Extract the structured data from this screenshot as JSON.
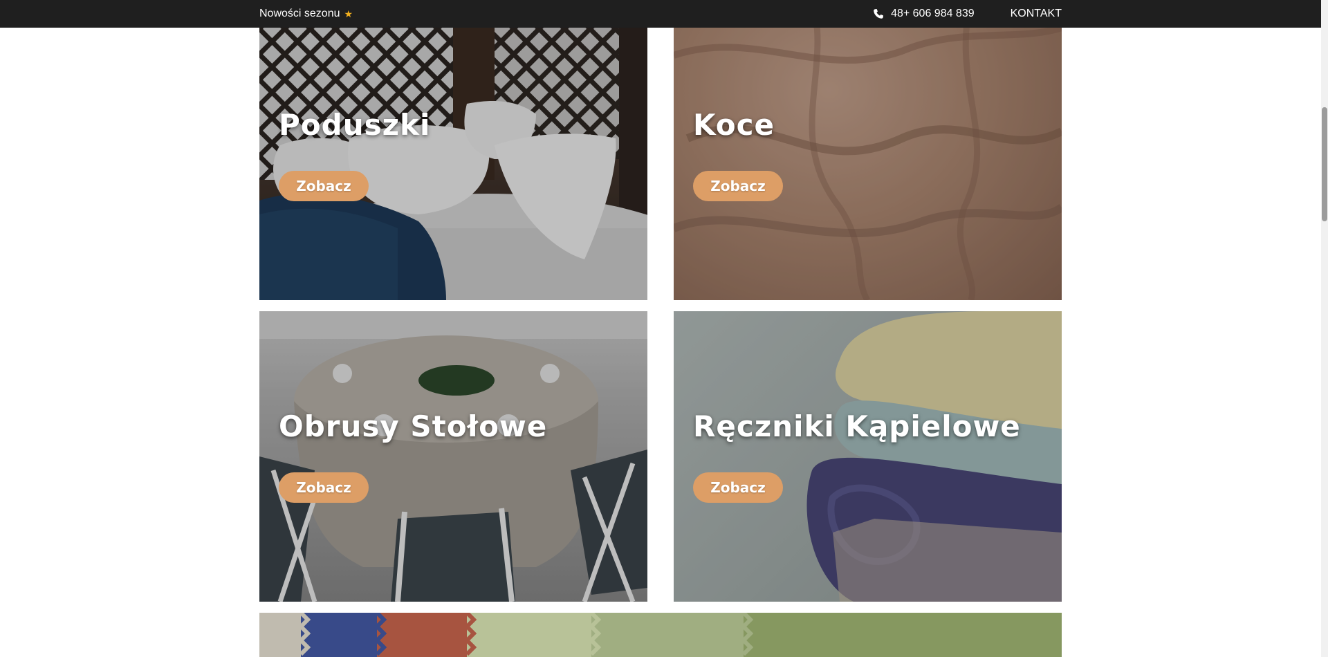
{
  "topbar": {
    "promo_label": "Nowości sezonu",
    "promo_icon": "star-icon",
    "phone_icon": "phone-icon",
    "phone": "48+ 606 984 839",
    "contact_label": "KONTAKT",
    "background": "#1f1f1f",
    "star_color": "#f2b01e"
  },
  "categories": [
    {
      "title": "Poduszki",
      "button_label": "Zobacz"
    },
    {
      "title": "Koce",
      "button_label": "Zobacz"
    },
    {
      "title": "Obrusy Stołowe",
      "button_label": "Zobacz"
    },
    {
      "title": "Ręczniki Kąpielowe",
      "button_label": "Zobacz"
    }
  ],
  "accent_color": "#dd9e66"
}
